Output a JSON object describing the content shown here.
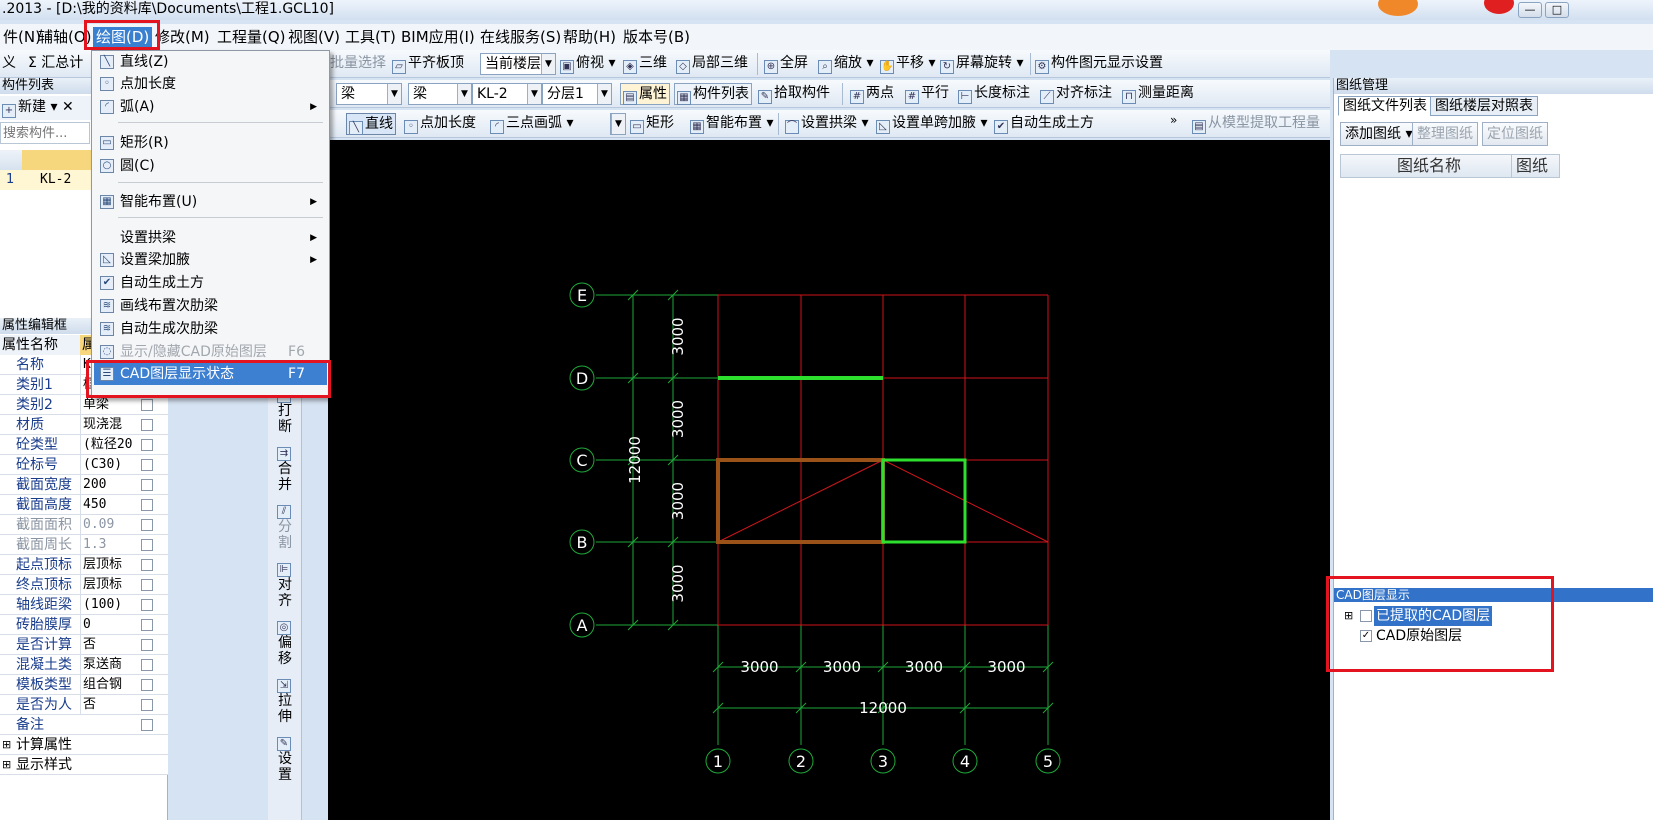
{
  "window": {
    "title": ".2013 - [D:\\我的资料库\\Documents\\工程1.GCL10]",
    "controls": [
      "—",
      "□"
    ]
  },
  "menubar": [
    "件(N)",
    "辅轴(O)",
    "绘图(D)",
    "修改(M)",
    "工程量(Q)",
    "视图(V)",
    "工具(T)",
    "BIM应用(I)",
    "在线服务(S)",
    "帮助(H)",
    "版本号(B)"
  ],
  "toolbar1": {
    "left": [
      "义",
      "Σ 汇总计"
    ],
    "batch_select": "批量选择",
    "flush_top": "平齐板顶",
    "floor_select": "当前楼层",
    "views": [
      "俯视",
      "三维",
      "局部三维"
    ],
    "fullscreen": "全屏",
    "zoom": "缩放",
    "pan": "平移",
    "rotate": "屏幕旋转",
    "display_settings": "构件图元显示设置"
  },
  "toolbar2": {
    "combo1": "梁",
    "combo2": "梁",
    "combo3": "KL-2",
    "combo4": "分层1",
    "attr": "属性",
    "comp_list": "构件列表",
    "pick": "拾取构件",
    "two_points": "两点",
    "parallel": "平行",
    "len_mark": "长度标注",
    "align_mark": "对齐标注",
    "measure": "测量距离"
  },
  "toolbar3": {
    "line": "直线",
    "point_len": "点加长度",
    "arc3": "三点画弧",
    "rect": "矩形",
    "smart": "智能布置",
    "arch_beam": "设置拱梁",
    "haunch": "设置单跨加腋",
    "auto_earth": "自动生成土方",
    "extract": "从模型提取工程量"
  },
  "left_panel": {
    "list_title": "构件列表",
    "new_btn": "新建",
    "delete_btn": "✕",
    "search_placeholder": "搜索构件...",
    "rows": [
      {
        "no": "1",
        "name": "KL-2"
      }
    ],
    "prop_title": "属性编辑框",
    "prop_headers": [
      "属性名称",
      "属"
    ],
    "props": [
      {
        "name": "名称",
        "value": "K",
        "grey": false
      },
      {
        "name": "类别1",
        "value": "框架梁",
        "grey": false
      },
      {
        "name": "类别2",
        "value": "单梁",
        "grey": false
      },
      {
        "name": "材质",
        "value": "现浇混",
        "grey": false
      },
      {
        "name": "砼类型",
        "value": "(粒径20",
        "grey": false
      },
      {
        "name": "砼标号",
        "value": "(C30)",
        "grey": false
      },
      {
        "name": "截面宽度",
        "value": "200",
        "grey": false
      },
      {
        "name": "截面高度",
        "value": "450",
        "grey": false
      },
      {
        "name": "截面面积",
        "value": "0.09",
        "grey": true
      },
      {
        "name": "截面周长",
        "value": "1.3",
        "grey": true
      },
      {
        "name": "起点顶标",
        "value": "层顶标",
        "grey": false
      },
      {
        "name": "终点顶标",
        "value": "层顶标",
        "grey": false
      },
      {
        "name": "轴线距梁",
        "value": "(100)",
        "grey": false
      },
      {
        "name": "砖胎膜厚",
        "value": "0",
        "grey": false
      },
      {
        "name": "是否计算",
        "value": "否",
        "grey": false
      },
      {
        "name": "混凝土类",
        "value": "泵送商",
        "grey": false
      },
      {
        "name": "模板类型",
        "value": "组合钢",
        "grey": false
      },
      {
        "name": "是否为人",
        "value": "否",
        "grey": false
      },
      {
        "name": "备注",
        "value": "",
        "grey": false
      }
    ],
    "groups": [
      "计算属性",
      "显示样式"
    ]
  },
  "vertical_toolbar": [
    "打断",
    "合并",
    "分割",
    "对齐",
    "偏移",
    "拉伸",
    "设置"
  ],
  "dropdown_menu": {
    "items": [
      {
        "label": "直线(Z)",
        "icon": "line-icon",
        "glyph": "╲",
        "arrow": false,
        "key": "",
        "disabled": false,
        "highlight": false
      },
      {
        "label": "点加长度",
        "icon": "point-length-icon",
        "glyph": "◦",
        "arrow": false,
        "key": "",
        "disabled": false,
        "highlight": false
      },
      {
        "label": "弧(A)",
        "icon": "arc-icon",
        "glyph": "◜",
        "arrow": true,
        "key": "",
        "disabled": false,
        "highlight": false
      },
      {
        "label": "矩形(R)",
        "icon": "rectangle-icon",
        "glyph": "▭",
        "arrow": false,
        "key": "",
        "disabled": false,
        "highlight": false
      },
      {
        "label": "圆(C)",
        "icon": "circle-icon",
        "glyph": "○",
        "arrow": false,
        "key": "",
        "disabled": false,
        "highlight": false
      },
      {
        "label": "智能布置(U)",
        "icon": "smart-layout-icon",
        "glyph": "▦",
        "arrow": true,
        "key": "",
        "disabled": false,
        "highlight": false
      },
      {
        "label": "设置拱梁",
        "icon": "",
        "glyph": "",
        "arrow": true,
        "key": "",
        "disabled": false,
        "highlight": false
      },
      {
        "label": "设置梁加腋",
        "icon": "haunch-icon",
        "glyph": "◺",
        "arrow": true,
        "key": "",
        "disabled": false,
        "highlight": false
      },
      {
        "label": "自动生成土方",
        "icon": "earthwork-icon",
        "glyph": "✔",
        "arrow": false,
        "key": "",
        "disabled": false,
        "highlight": false
      },
      {
        "label": "画线布置次肋梁",
        "icon": "rib-line-icon",
        "glyph": "≋",
        "arrow": false,
        "key": "",
        "disabled": false,
        "highlight": false
      },
      {
        "label": "自动生成次肋梁",
        "icon": "rib-auto-icon",
        "glyph": "≋",
        "arrow": false,
        "key": "",
        "disabled": false,
        "highlight": false
      },
      {
        "label": "显示/隐藏CAD原始图层",
        "icon": "cad-toggle-icon",
        "glyph": "◌",
        "arrow": false,
        "key": "F6",
        "disabled": true,
        "highlight": false
      },
      {
        "label": "CAD图层显示状态",
        "icon": "cad-layer-icon",
        "glyph": "☰",
        "arrow": false,
        "key": "F7",
        "disabled": false,
        "highlight": true
      }
    ]
  },
  "drawing": {
    "rows": [
      "E",
      "D",
      "C",
      "B",
      "A"
    ],
    "cols": [
      "1",
      "2",
      "3",
      "4",
      "5"
    ],
    "vertical_dims": [
      "3000",
      "3000",
      "3000",
      "3000"
    ],
    "vertical_total": "12000",
    "horizontal_dims": [
      "3000",
      "3000",
      "3000",
      "3000"
    ],
    "horizontal_total": "12000",
    "colors": {
      "axis": "#1fa83a",
      "grid": "#d0151a",
      "beam_green": "#2ee02e",
      "beam_brown": "#9a5218",
      "text": "#ffffff"
    }
  },
  "right_panel": {
    "title": "图纸管理",
    "tabs": [
      "图纸文件列表",
      "图纸楼层对照表"
    ],
    "buttons": [
      "添加图纸",
      "整理图纸",
      "定位图纸"
    ],
    "col_headers": [
      "图纸名称",
      "图纸"
    ],
    "cad_title": "CAD图层显示",
    "cad_items": [
      {
        "label": "已提取的CAD图层",
        "checked": false,
        "selected": true
      },
      {
        "label": "CAD原始图层",
        "checked": true,
        "selected": false
      }
    ]
  }
}
